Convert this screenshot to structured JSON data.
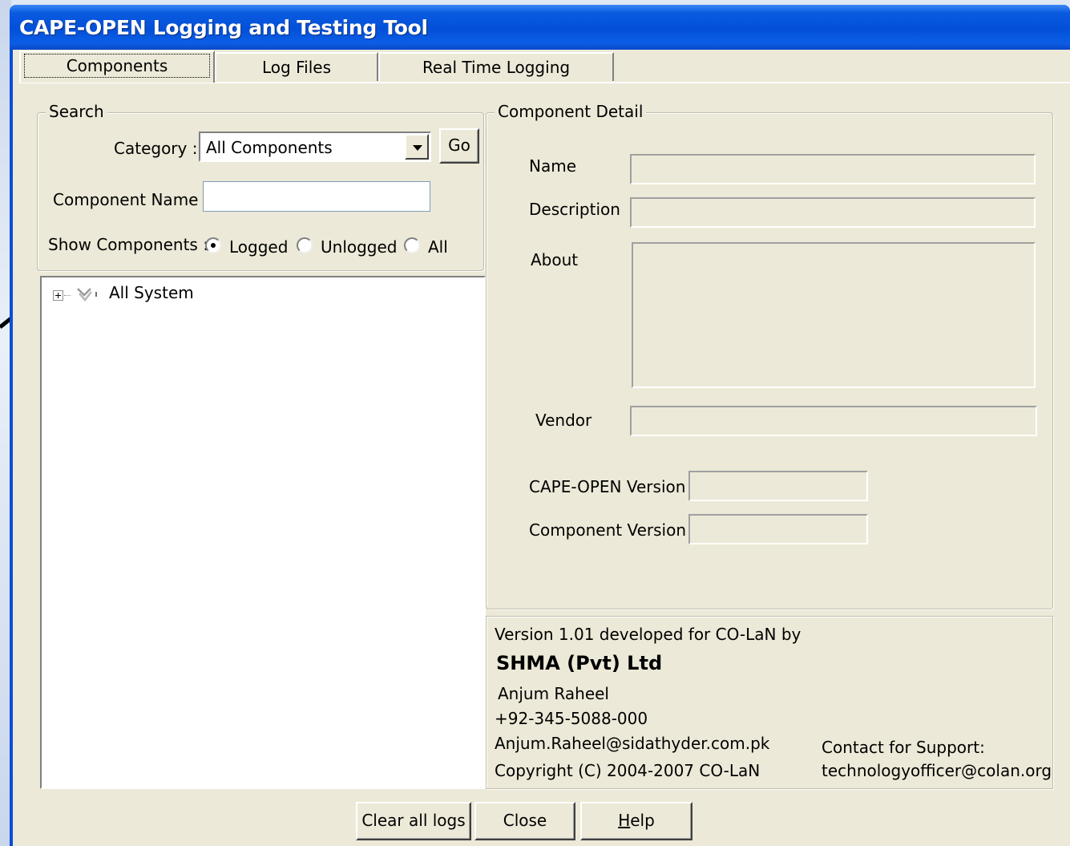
{
  "window": {
    "title": "CAPE-OPEN Logging and Testing Tool"
  },
  "tabs": [
    {
      "label": "Components"
    },
    {
      "label": "Log Files"
    },
    {
      "label": "Real Time Logging"
    }
  ],
  "search": {
    "group_title": "Search",
    "category_label": "Category :",
    "category_value": "All Components",
    "go_label": "Go",
    "component_name_label": "Component Name :",
    "component_name_value": "",
    "show_components_label": "Show Components :",
    "radio_options": [
      {
        "label": "Logged",
        "checked": true
      },
      {
        "label": "Unlogged",
        "checked": false
      },
      {
        "label": "All",
        "checked": false
      }
    ]
  },
  "tree": {
    "root_label": "All System",
    "root_icon": "system-icon"
  },
  "detail": {
    "group_title": "Component Detail",
    "name_label": "Name",
    "description_label": "Description",
    "about_label": "About",
    "vendor_label": "Vendor",
    "capeopen_version_label": "CAPE-OPEN Version",
    "component_version_label": "Component Version"
  },
  "info": {
    "version_line": "Version 1.01 developed for CO-LaN by",
    "company": "SHMA (Pvt) Ltd",
    "person": "Anjum Raheel",
    "phone": "+92-345-5088-000",
    "email": "Anjum.Raheel@sidathyder.com.pk",
    "copyright": "Copyright (C) 2004-2007 CO-LaN",
    "support_label": "Contact for Support:",
    "support_email": "technologyofficer@colan.org"
  },
  "buttons": {
    "clear_logs": "Clear all logs",
    "close": "Close",
    "help": "Help"
  },
  "colors": {
    "titlebar": "#0350d8",
    "dialog_bg": "#ece9d8",
    "arrow": "#000000"
  }
}
